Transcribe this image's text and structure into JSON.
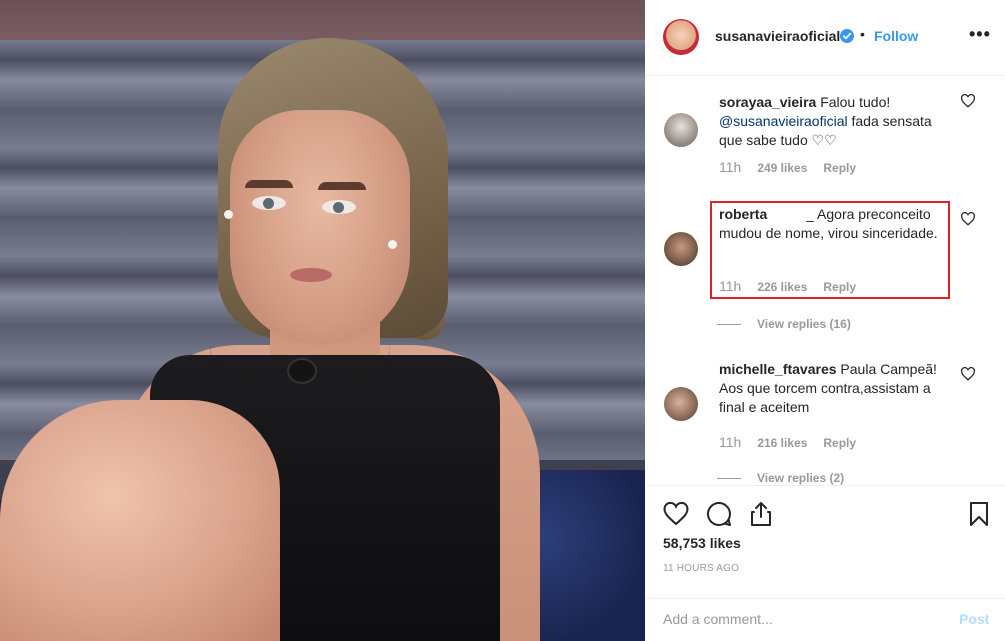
{
  "header": {
    "username": "susanavieiraoficial",
    "separator": "•",
    "follow_label": "Follow",
    "more_label": "•••"
  },
  "comments": [
    {
      "username": "sorayaa_vieira",
      "text_before": " Falou tudo!",
      "mention": "@susanavieiraoficial",
      "text_after": " fada sensata que sabe tudo ♡♡",
      "time": "11h",
      "likes": "249 likes",
      "reply_label": "Reply"
    },
    {
      "username": "roberta",
      "text": "          _ Agora preconceito mudou de nome, virou sinceridade.",
      "time": "11h",
      "likes": "226 likes",
      "reply_label": "Reply",
      "view_replies": "View replies (16)"
    },
    {
      "username": "michelle_ftavares",
      "text": " Paula Campeã! Aos que torcem contra,assistam a final e aceitem",
      "time": "11h",
      "likes": "216 likes",
      "reply_label": "Reply",
      "view_replies": "View replies (2)"
    }
  ],
  "post": {
    "likes": "58,753 likes",
    "time_ago": "11 HOURS AGO"
  },
  "add_comment": {
    "placeholder": "Add a comment...",
    "post_label": "Post"
  },
  "colors": {
    "accent": "#3897f0",
    "highlight": "#d8232a",
    "muted": "#999999",
    "post_disabled": "#b2dffc"
  }
}
